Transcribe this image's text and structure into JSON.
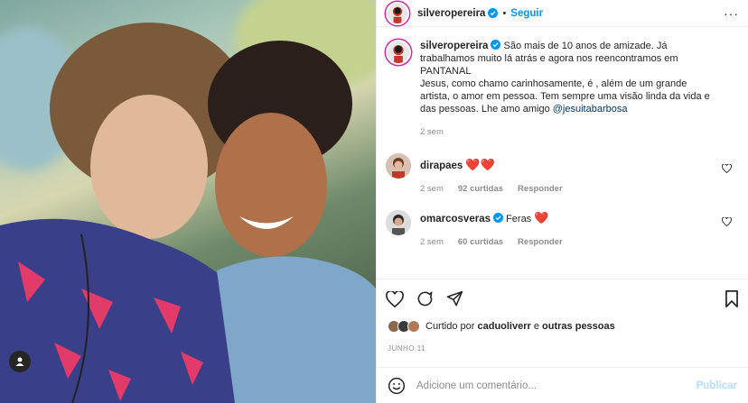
{
  "post": {
    "author": "silveropereira",
    "follow_label": "Seguir",
    "dot": "•",
    "more_label": "···",
    "caption": {
      "text_lines": [
        "São mais de 10 anos de amizade. Já",
        "trabalhamos muito lá atrás e agora nos reencontramos em",
        "PANTANAL",
        "Jesus, como chamo carinhosamente, é , além de um grande",
        "artista, o amor em pessoa. Tem sempre uma visão linda da vida e",
        "das pessoas. Lhe amo amigo"
      ],
      "mention": "@jesuitabarbosa",
      "time": "2 sem"
    },
    "comments": [
      {
        "author": "dirapaes",
        "text": "",
        "hearts": "❤️❤️",
        "time": "2 sem",
        "likes": "92 curtidas",
        "reply_label": "Responder"
      },
      {
        "author": "omarcosveras",
        "text": "Feras",
        "hearts": "❤️",
        "time": "2 sem",
        "likes": "60 curtidas",
        "reply_label": "Responder"
      }
    ],
    "liked_by": {
      "prefix": "Curtido por",
      "user": "caduoliverr",
      "connector": "e",
      "others": "outras pessoas"
    },
    "date": "JUNHO 11",
    "comment_input": {
      "placeholder": "Adicione um comentário...",
      "publish_label": "Publicar"
    }
  },
  "colors": {
    "accent": "#0095f6",
    "heart": "#ed4956",
    "muted": "#8e8e8e",
    "publish_disabled": "#b2dffc"
  },
  "icons": [
    "heart-icon",
    "comment-icon",
    "share-icon",
    "bookmark-icon",
    "emoji-icon",
    "verified-icon",
    "more-icon",
    "user-tag-icon"
  ]
}
